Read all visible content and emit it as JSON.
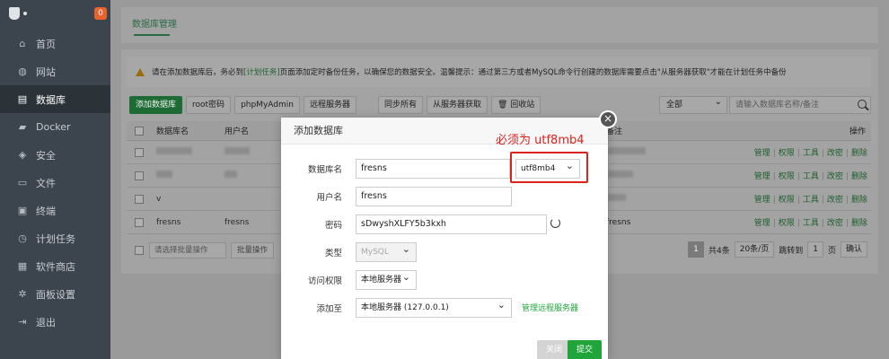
{
  "sidebar": {
    "badge": "0",
    "items": [
      {
        "label": "首页",
        "icon": "home-icon",
        "glyph": "⌂"
      },
      {
        "label": "网站",
        "icon": "globe-icon",
        "glyph": "◍"
      },
      {
        "label": "数据库",
        "icon": "database-icon",
        "glyph": "▤"
      },
      {
        "label": "Docker",
        "icon": "docker-icon",
        "glyph": "▰"
      },
      {
        "label": "安全",
        "icon": "shield-icon",
        "glyph": "◈"
      },
      {
        "label": "文件",
        "icon": "folder-icon",
        "glyph": "▭"
      },
      {
        "label": "终端",
        "icon": "terminal-icon",
        "glyph": "▣"
      },
      {
        "label": "计划任务",
        "icon": "clock-icon",
        "glyph": "◷"
      },
      {
        "label": "软件商店",
        "icon": "apps-icon",
        "glyph": "▦"
      },
      {
        "label": "面板设置",
        "icon": "gear-icon",
        "glyph": "✲"
      },
      {
        "label": "退出",
        "icon": "logout-icon",
        "glyph": "⇥"
      }
    ],
    "active_index": 2
  },
  "tabs": {
    "db_manage": "数据库管理"
  },
  "notice": {
    "prefix": "请在添加数据库后，务必到",
    "link": "[计划任务]",
    "suffix": "页面添加定时备份任务，以确保您的数据安全。温馨提示：通过第三方或者MySQL命令行创建的数据库需要点击\"从服务器获取\"才能在计划任务中备份"
  },
  "toolbar": {
    "add_db": "添加数据库",
    "root_pwd": "root密码",
    "phpmyadmin": "phpMyAdmin",
    "remote_server": "远程服务器",
    "sync_all": "同步所有",
    "fetch_server": "从服务器获取",
    "recycle": "🗑 回收站",
    "filter_all": "全部",
    "search_placeholder": "请输入数据库名称/备注"
  },
  "table": {
    "headers": {
      "name": "数据库名",
      "user": "用户名",
      "note": "备注",
      "op": "操作"
    },
    "op_links": [
      "管理",
      "权限",
      "工具",
      "改密",
      "删除"
    ],
    "rows": [
      {
        "name": "",
        "user": "",
        "note": ""
      },
      {
        "name": "",
        "user": "",
        "note": ""
      },
      {
        "name": "v",
        "user": "",
        "note": ""
      },
      {
        "name": "fresns",
        "user": "fresns",
        "note": "fresns"
      }
    ]
  },
  "pager": {
    "batch_placeholder": "请选择批量操作",
    "batch_btn": "批量操作",
    "current": "1",
    "total": "共4条",
    "per_page": "20条/页",
    "jump_label": "跳转到",
    "jump_value": "1",
    "page_unit": "页",
    "confirm": "确认"
  },
  "modal": {
    "title": "添加数据库",
    "close": "×",
    "db_name_label": "数据库名",
    "db_name_value": "fresns",
    "charset_value": "utf8mb4",
    "username_label": "用户名",
    "username_value": "fresns",
    "password_label": "密码",
    "password_value": "sDwyshXLFY5b3kxh",
    "type_label": "类型",
    "type_value": "MySQL",
    "access_label": "访问权限",
    "access_value": "本地服务器",
    "add_to_label": "添加至",
    "add_to_value": "本地服务器 (127.0.0.1)",
    "manage_remote": "管理远程服务器",
    "cancel": "关闭",
    "submit": "提交"
  },
  "annotation": {
    "text": "必须为 utf8mb4",
    "color": "#e0201b"
  }
}
